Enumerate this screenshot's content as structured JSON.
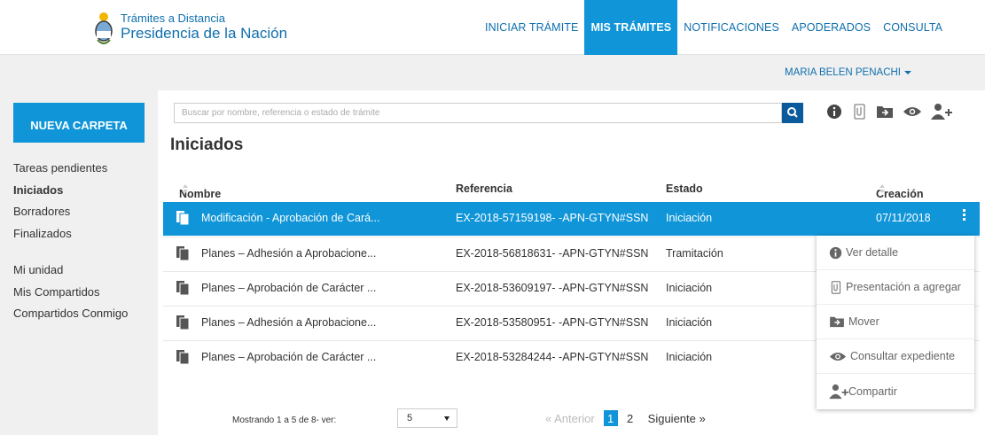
{
  "brand": {
    "subtitle": "Trámites a Distancia",
    "title": "Presidencia de la Nación"
  },
  "nav": [
    {
      "label": "INICIAR TRÁMITE",
      "active": false
    },
    {
      "label": "MIS TRÁMITES",
      "active": true
    },
    {
      "label": "NOTIFICACIONES",
      "active": false
    },
    {
      "label": "APODERADOS",
      "active": false
    },
    {
      "label": "CONSULTA",
      "active": false
    }
  ],
  "user": {
    "name": "MARIA BELEN PENACHI"
  },
  "sidebar": {
    "new_folder_label": "NUEVA CARPETA",
    "items": [
      {
        "label": "Tareas pendientes"
      },
      {
        "label": "Iniciados"
      },
      {
        "label": "Borradores"
      },
      {
        "label": "Finalizados"
      },
      {
        "label": "Mi unidad"
      },
      {
        "label": "Mis Compartidos"
      },
      {
        "label": "Compartidos Conmigo"
      }
    ]
  },
  "search": {
    "placeholder": "Buscar por nombre, referencia o estado de trámite",
    "icon": "search-icon"
  },
  "toolbar": {
    "icons": [
      "info-icon",
      "attach-document-icon",
      "move-folder-icon",
      "view-eye-icon",
      "add-user-icon"
    ]
  },
  "page": {
    "title": "Iniciados"
  },
  "table": {
    "columns": {
      "name": "Nombre",
      "reference": "Referencia",
      "status": "Estado",
      "created": "Creación"
    },
    "rows": [
      {
        "name": "Modificación - Aprobación de Cará...",
        "reference": "EX-2018-57159198- -APN-GTYN#SSN",
        "status": "Iniciación",
        "created": "07/11/2018",
        "selected": true
      },
      {
        "name": "Planes – Adhesión a Aprobacione...",
        "reference": "EX-2018-56818631- -APN-GTYN#SSN",
        "status": "Tramitación",
        "created": "",
        "selected": false
      },
      {
        "name": "Planes – Aprobación de Carácter ...",
        "reference": "EX-2018-53609197- -APN-GTYN#SSN",
        "status": "Iniciación",
        "created": "",
        "selected": false
      },
      {
        "name": "Planes – Adhesión a Aprobacione...",
        "reference": "EX-2018-53580951- -APN-GTYN#SSN",
        "status": "Iniciación",
        "created": "",
        "selected": false
      },
      {
        "name": "Planes – Aprobación de Carácter ...",
        "reference": "EX-2018-53284244- -APN-GTYN#SSN",
        "status": "Iniciación",
        "created": "",
        "selected": false
      }
    ]
  },
  "context_menu": {
    "items": [
      {
        "label": "Ver detalle",
        "icon": "info-icon"
      },
      {
        "label": "Presentación a agregar",
        "icon": "attach-document-icon"
      },
      {
        "label": "Mover",
        "icon": "move-folder-icon"
      },
      {
        "label": "Consultar expediente",
        "icon": "view-eye-icon"
      },
      {
        "label": "Compartir",
        "icon": "add-user-icon"
      }
    ]
  },
  "pagination": {
    "info": "Mostrando 1 a 5 de 8- ver:",
    "page_size": "5",
    "prev_label": "« Anterior",
    "pages": [
      "1",
      "2"
    ],
    "current_page": "1",
    "next_label": "Siguiente »"
  },
  "colors": {
    "primary": "#0f95d8",
    "link": "#0f6fae",
    "search_button": "#0a5a9c",
    "panel_bg": "#f0f0f0"
  }
}
